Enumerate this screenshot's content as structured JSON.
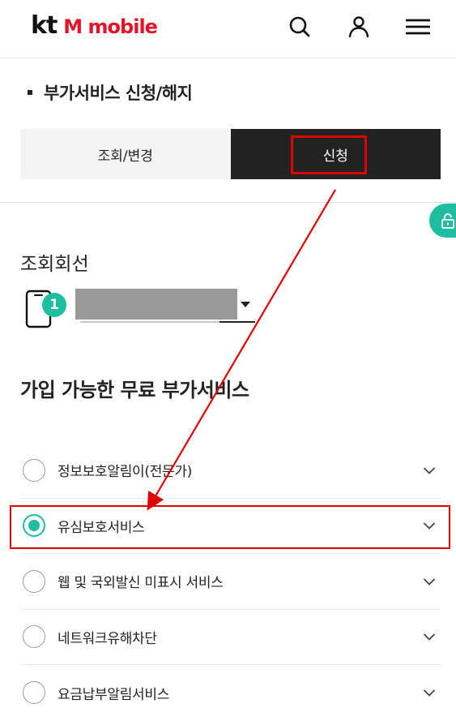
{
  "header": {
    "logo_kt": "kt",
    "logo_mobile": "M mobile",
    "icons": [
      "search-icon",
      "user-icon",
      "menu-icon"
    ]
  },
  "page": {
    "title": "부가서비스 신청/해지"
  },
  "tabs": [
    {
      "label": "조회/변경",
      "selected": false
    },
    {
      "label": "신청",
      "selected": true
    }
  ],
  "line": {
    "label": "조회회선",
    "badge": "1",
    "selected_value": "",
    "icon": "phone-icon"
  },
  "services": {
    "title": "가입 가능한 무료 부가서비스",
    "items": [
      {
        "name": "정보보호알림이(전문가)",
        "checked": false
      },
      {
        "name": "유심보호서비스",
        "checked": true
      },
      {
        "name": "웹 및 국외발신 미표시 서비스",
        "checked": false
      },
      {
        "name": "네트워크유해차단",
        "checked": false
      },
      {
        "name": "요금납부알림서비스",
        "checked": false
      }
    ]
  },
  "colors": {
    "brand_red": "#e5132a",
    "accent": "#1ebea0",
    "tab_active_bg": "#222222",
    "annotation": "#e00000"
  }
}
